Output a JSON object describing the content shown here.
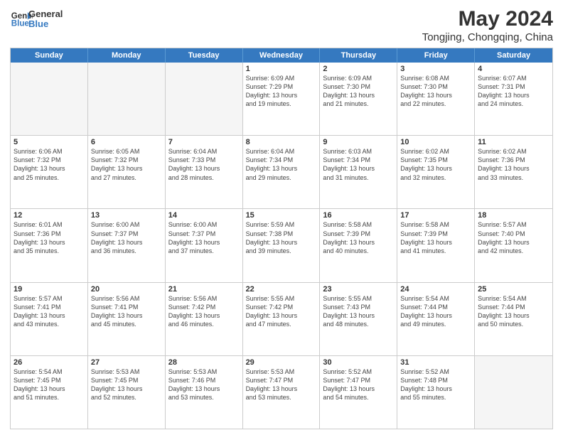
{
  "header": {
    "logo_line1": "General",
    "logo_line2": "Blue",
    "main_title": "May 2024",
    "subtitle": "Tongjing, Chongqing, China"
  },
  "days_of_week": [
    "Sunday",
    "Monday",
    "Tuesday",
    "Wednesday",
    "Thursday",
    "Friday",
    "Saturday"
  ],
  "weeks": [
    [
      {
        "day": "",
        "empty": true,
        "lines": []
      },
      {
        "day": "",
        "empty": true,
        "lines": []
      },
      {
        "day": "",
        "empty": true,
        "lines": []
      },
      {
        "day": "1",
        "lines": [
          "Sunrise: 6:09 AM",
          "Sunset: 7:29 PM",
          "Daylight: 13 hours",
          "and 19 minutes."
        ]
      },
      {
        "day": "2",
        "lines": [
          "Sunrise: 6:09 AM",
          "Sunset: 7:30 PM",
          "Daylight: 13 hours",
          "and 21 minutes."
        ]
      },
      {
        "day": "3",
        "lines": [
          "Sunrise: 6:08 AM",
          "Sunset: 7:30 PM",
          "Daylight: 13 hours",
          "and 22 minutes."
        ]
      },
      {
        "day": "4",
        "lines": [
          "Sunrise: 6:07 AM",
          "Sunset: 7:31 PM",
          "Daylight: 13 hours",
          "and 24 minutes."
        ]
      }
    ],
    [
      {
        "day": "5",
        "lines": [
          "Sunrise: 6:06 AM",
          "Sunset: 7:32 PM",
          "Daylight: 13 hours",
          "and 25 minutes."
        ]
      },
      {
        "day": "6",
        "lines": [
          "Sunrise: 6:05 AM",
          "Sunset: 7:32 PM",
          "Daylight: 13 hours",
          "and 27 minutes."
        ]
      },
      {
        "day": "7",
        "lines": [
          "Sunrise: 6:04 AM",
          "Sunset: 7:33 PM",
          "Daylight: 13 hours",
          "and 28 minutes."
        ]
      },
      {
        "day": "8",
        "lines": [
          "Sunrise: 6:04 AM",
          "Sunset: 7:34 PM",
          "Daylight: 13 hours",
          "and 29 minutes."
        ]
      },
      {
        "day": "9",
        "lines": [
          "Sunrise: 6:03 AM",
          "Sunset: 7:34 PM",
          "Daylight: 13 hours",
          "and 31 minutes."
        ]
      },
      {
        "day": "10",
        "lines": [
          "Sunrise: 6:02 AM",
          "Sunset: 7:35 PM",
          "Daylight: 13 hours",
          "and 32 minutes."
        ]
      },
      {
        "day": "11",
        "lines": [
          "Sunrise: 6:02 AM",
          "Sunset: 7:36 PM",
          "Daylight: 13 hours",
          "and 33 minutes."
        ]
      }
    ],
    [
      {
        "day": "12",
        "lines": [
          "Sunrise: 6:01 AM",
          "Sunset: 7:36 PM",
          "Daylight: 13 hours",
          "and 35 minutes."
        ]
      },
      {
        "day": "13",
        "lines": [
          "Sunrise: 6:00 AM",
          "Sunset: 7:37 PM",
          "Daylight: 13 hours",
          "and 36 minutes."
        ]
      },
      {
        "day": "14",
        "lines": [
          "Sunrise: 6:00 AM",
          "Sunset: 7:37 PM",
          "Daylight: 13 hours",
          "and 37 minutes."
        ]
      },
      {
        "day": "15",
        "lines": [
          "Sunrise: 5:59 AM",
          "Sunset: 7:38 PM",
          "Daylight: 13 hours",
          "and 39 minutes."
        ]
      },
      {
        "day": "16",
        "lines": [
          "Sunrise: 5:58 AM",
          "Sunset: 7:39 PM",
          "Daylight: 13 hours",
          "and 40 minutes."
        ]
      },
      {
        "day": "17",
        "lines": [
          "Sunrise: 5:58 AM",
          "Sunset: 7:39 PM",
          "Daylight: 13 hours",
          "and 41 minutes."
        ]
      },
      {
        "day": "18",
        "lines": [
          "Sunrise: 5:57 AM",
          "Sunset: 7:40 PM",
          "Daylight: 13 hours",
          "and 42 minutes."
        ]
      }
    ],
    [
      {
        "day": "19",
        "lines": [
          "Sunrise: 5:57 AM",
          "Sunset: 7:41 PM",
          "Daylight: 13 hours",
          "and 43 minutes."
        ]
      },
      {
        "day": "20",
        "lines": [
          "Sunrise: 5:56 AM",
          "Sunset: 7:41 PM",
          "Daylight: 13 hours",
          "and 45 minutes."
        ]
      },
      {
        "day": "21",
        "lines": [
          "Sunrise: 5:56 AM",
          "Sunset: 7:42 PM",
          "Daylight: 13 hours",
          "and 46 minutes."
        ]
      },
      {
        "day": "22",
        "lines": [
          "Sunrise: 5:55 AM",
          "Sunset: 7:42 PM",
          "Daylight: 13 hours",
          "and 47 minutes."
        ]
      },
      {
        "day": "23",
        "lines": [
          "Sunrise: 5:55 AM",
          "Sunset: 7:43 PM",
          "Daylight: 13 hours",
          "and 48 minutes."
        ]
      },
      {
        "day": "24",
        "lines": [
          "Sunrise: 5:54 AM",
          "Sunset: 7:44 PM",
          "Daylight: 13 hours",
          "and 49 minutes."
        ]
      },
      {
        "day": "25",
        "lines": [
          "Sunrise: 5:54 AM",
          "Sunset: 7:44 PM",
          "Daylight: 13 hours",
          "and 50 minutes."
        ]
      }
    ],
    [
      {
        "day": "26",
        "lines": [
          "Sunrise: 5:54 AM",
          "Sunset: 7:45 PM",
          "Daylight: 13 hours",
          "and 51 minutes."
        ]
      },
      {
        "day": "27",
        "lines": [
          "Sunrise: 5:53 AM",
          "Sunset: 7:45 PM",
          "Daylight: 13 hours",
          "and 52 minutes."
        ]
      },
      {
        "day": "28",
        "lines": [
          "Sunrise: 5:53 AM",
          "Sunset: 7:46 PM",
          "Daylight: 13 hours",
          "and 53 minutes."
        ]
      },
      {
        "day": "29",
        "lines": [
          "Sunrise: 5:53 AM",
          "Sunset: 7:47 PM",
          "Daylight: 13 hours",
          "and 53 minutes."
        ]
      },
      {
        "day": "30",
        "lines": [
          "Sunrise: 5:52 AM",
          "Sunset: 7:47 PM",
          "Daylight: 13 hours",
          "and 54 minutes."
        ]
      },
      {
        "day": "31",
        "lines": [
          "Sunrise: 5:52 AM",
          "Sunset: 7:48 PM",
          "Daylight: 13 hours",
          "and 55 minutes."
        ]
      },
      {
        "day": "",
        "empty": true,
        "lines": []
      }
    ]
  ]
}
